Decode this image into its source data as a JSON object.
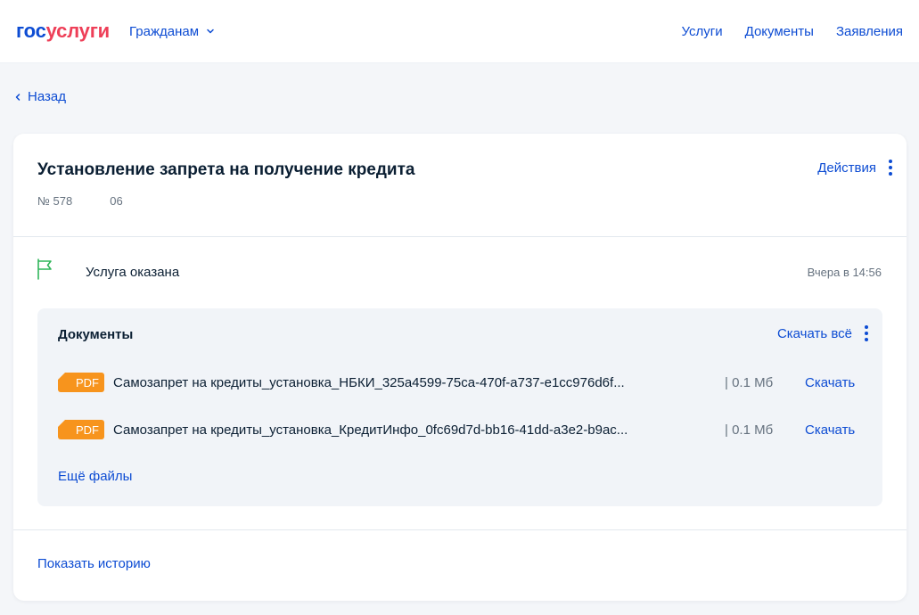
{
  "header": {
    "logo_part1": "гос",
    "logo_part2": "услуги",
    "audience": "Гражданам",
    "nav": [
      "Услуги",
      "Документы",
      "Заявления"
    ]
  },
  "back": "Назад",
  "application": {
    "title": "Установление запрета на получение кредита",
    "number_prefix": "№ 578",
    "number_suffix": "06",
    "actions": "Действия"
  },
  "status": {
    "label": "Услуга оказана",
    "time": "Вчера в 14:56"
  },
  "documents": {
    "title": "Документы",
    "download_all": "Скачать всё",
    "files": [
      {
        "type": "PDF",
        "name": "Самозапрет на кредиты_установка_НБКИ_325a4599-75ca-470f-a737-e1cc976d6f...",
        "size": "| 0.1 Мб",
        "action": "Скачать"
      },
      {
        "type": "PDF",
        "name": "Самозапрет на кредиты_установка_КредитИнфо_0fc69d7d-bb16-41dd-a3e2-b9ac...",
        "size": "| 0.1 Мб",
        "action": "Скачать"
      }
    ],
    "more_files": "Ещё файлы"
  },
  "show_history": "Показать историю",
  "colors": {
    "brand_blue": "#0d4cd3",
    "brand_red": "#ee3f58",
    "pdf_orange": "#f7941d",
    "status_green": "#2fb55a",
    "text_dark": "#0b1f33",
    "text_muted": "#66727f"
  },
  "icons": {
    "audience_dropdown": "chevron-down-icon",
    "back": "chevron-left-icon",
    "actions_menu": "kebab-menu-icon",
    "status": "flag-icon",
    "docs_menu": "kebab-menu-icon"
  }
}
